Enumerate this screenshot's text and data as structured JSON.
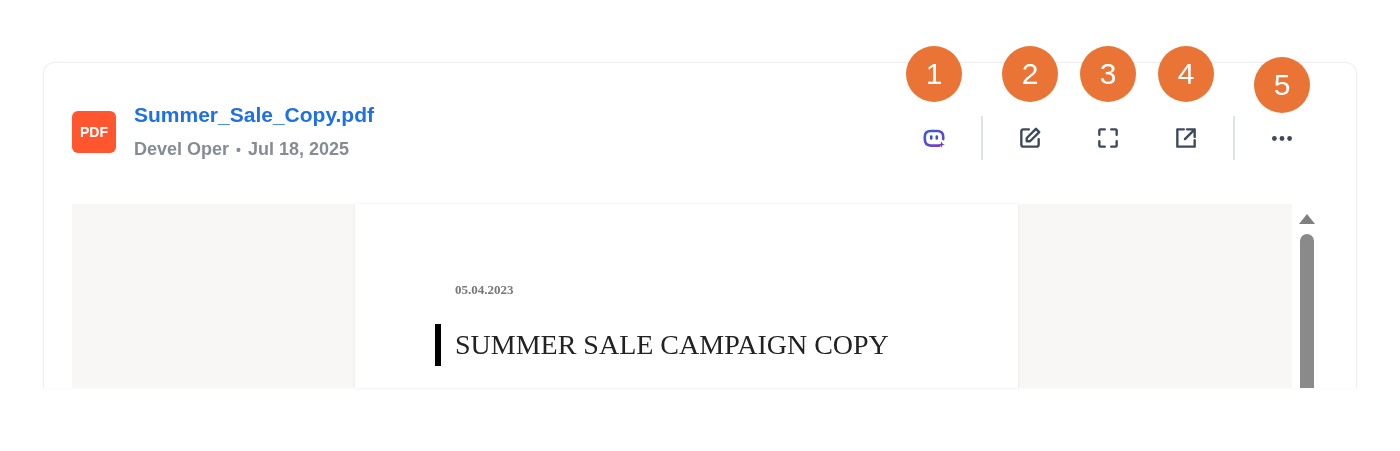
{
  "file": {
    "type_label": "PDF",
    "name": "Summer_Sale_Copy.pdf",
    "author": "Devel Oper",
    "separator": "•",
    "date": "Jul 18, 2025"
  },
  "toolbar": [
    {
      "kind": "assistant",
      "badge": "1"
    },
    {
      "kind": "divider"
    },
    {
      "kind": "edit",
      "badge": "2"
    },
    {
      "kind": "fullscreen",
      "badge": "3"
    },
    {
      "kind": "open-external",
      "badge": "4"
    },
    {
      "kind": "divider"
    },
    {
      "kind": "more",
      "badge": "5"
    }
  ],
  "document": {
    "date": "05.04.2023",
    "heading": "SUMMER SALE CAMPAIGN COPY"
  }
}
